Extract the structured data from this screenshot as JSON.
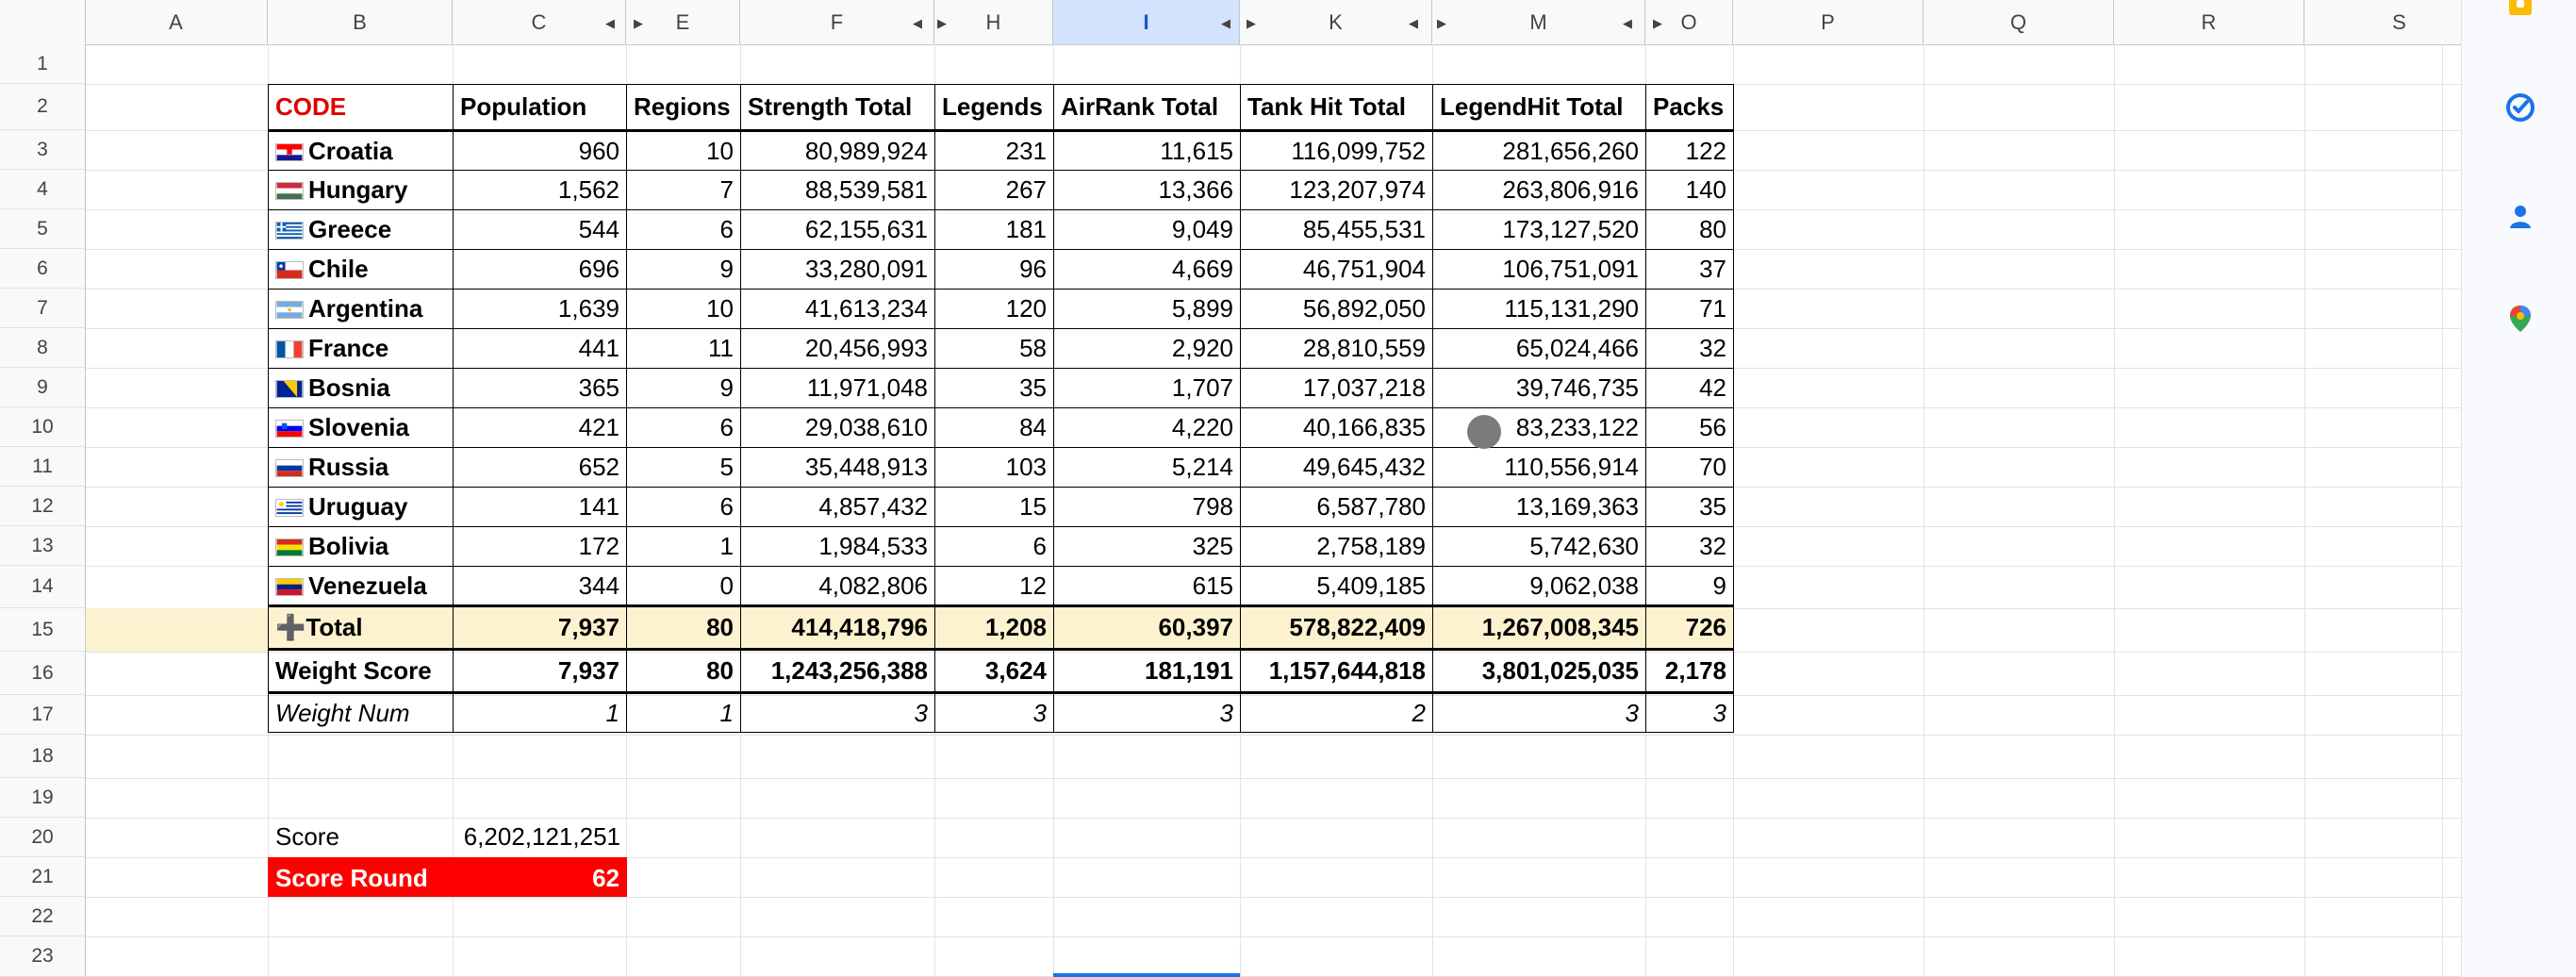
{
  "columns": [
    "A",
    "B",
    "C",
    "E",
    "F",
    "H",
    "I",
    "K",
    "M",
    "O",
    "P",
    "Q",
    "R",
    "S"
  ],
  "rows": [
    "1",
    "2",
    "3",
    "4",
    "5",
    "6",
    "7",
    "8",
    "9",
    "10",
    "11",
    "12",
    "13",
    "14",
    "15",
    "16",
    "17",
    "18",
    "19",
    "20",
    "21",
    "22",
    "23"
  ],
  "table": {
    "headers": [
      "CODE",
      "Population",
      "Regions",
      "Strength Total",
      "Legends",
      "AirRank Total",
      "Tank Hit Total",
      "LegendHit Total",
      "Packs"
    ],
    "rows": [
      {
        "flag": "Croatia",
        "name": "Croatia",
        "cells": [
          "960",
          "10",
          "80,989,924",
          "231",
          "11,615",
          "116,099,752",
          "281,656,260",
          "122"
        ]
      },
      {
        "flag": "Hungary",
        "name": "Hungary",
        "cells": [
          "1,562",
          "7",
          "88,539,581",
          "267",
          "13,366",
          "123,207,974",
          "263,806,916",
          "140"
        ]
      },
      {
        "flag": "Greece",
        "name": "Greece",
        "cells": [
          "544",
          "6",
          "62,155,631",
          "181",
          "9,049",
          "85,455,531",
          "173,127,520",
          "80"
        ]
      },
      {
        "flag": "Chile",
        "name": "Chile",
        "cells": [
          "696",
          "9",
          "33,280,091",
          "96",
          "4,669",
          "46,751,904",
          "106,751,091",
          "37"
        ]
      },
      {
        "flag": "Argentina",
        "name": "Argentina",
        "cells": [
          "1,639",
          "10",
          "41,613,234",
          "120",
          "5,899",
          "56,892,050",
          "115,131,290",
          "71"
        ]
      },
      {
        "flag": "France",
        "name": "France",
        "cells": [
          "441",
          "11",
          "20,456,993",
          "58",
          "2,920",
          "28,810,559",
          "65,024,466",
          "32"
        ]
      },
      {
        "flag": "Bosnia",
        "name": "Bosnia",
        "cells": [
          "365",
          "9",
          "11,971,048",
          "35",
          "1,707",
          "17,037,218",
          "39,746,735",
          "42"
        ]
      },
      {
        "flag": "Slovenia",
        "name": "Slovenia",
        "cells": [
          "421",
          "6",
          "29,038,610",
          "84",
          "4,220",
          "40,166,835",
          "83,233,122",
          "56"
        ]
      },
      {
        "flag": "Russia",
        "name": "Russia",
        "cells": [
          "652",
          "5",
          "35,448,913",
          "103",
          "5,214",
          "49,645,432",
          "110,556,914",
          "70"
        ]
      },
      {
        "flag": "Uruguay",
        "name": "Uruguay",
        "cells": [
          "141",
          "6",
          "4,857,432",
          "15",
          "798",
          "6,587,780",
          "13,169,363",
          "35"
        ]
      },
      {
        "flag": "Bolivia",
        "name": "Bolivia",
        "cells": [
          "172",
          "1",
          "1,984,533",
          "6",
          "325",
          "2,758,189",
          "5,742,630",
          "32"
        ]
      },
      {
        "flag": "Venezuela",
        "name": "Venezuela",
        "cells": [
          "344",
          "0",
          "4,082,806",
          "12",
          "615",
          "5,409,185",
          "9,062,038",
          "9"
        ]
      }
    ],
    "total": {
      "icon": "➕",
      "label": "Total",
      "cells": [
        "7,937",
        "80",
        "414,418,796",
        "1,208",
        "60,397",
        "578,822,409",
        "1,267,008,345",
        "726"
      ]
    },
    "weight_score": {
      "label": "Weight Score",
      "cells": [
        "7,937",
        "80",
        "1,243,256,388",
        "3,624",
        "181,191",
        "1,157,644,818",
        "3,801,025,035",
        "2,178"
      ]
    },
    "weight_num": {
      "label": "Weight Num",
      "cells": [
        "1",
        "1",
        "3",
        "3",
        "3",
        "2",
        "3",
        "3"
      ]
    }
  },
  "score": {
    "label": "Score",
    "value": "6,202,121,251"
  },
  "score_round": {
    "label": "Score Round",
    "value": "62"
  },
  "side_panel_icons": [
    "keep-icon",
    "tasks-icon",
    "contacts-icon",
    "maps-icon"
  ],
  "colors": {
    "code_header": "#e00000",
    "total_row": "#fdf2d0",
    "score_round_bg": "#ff0000",
    "selected_column": "#d3e3fd"
  },
  "selected_column": "I"
}
